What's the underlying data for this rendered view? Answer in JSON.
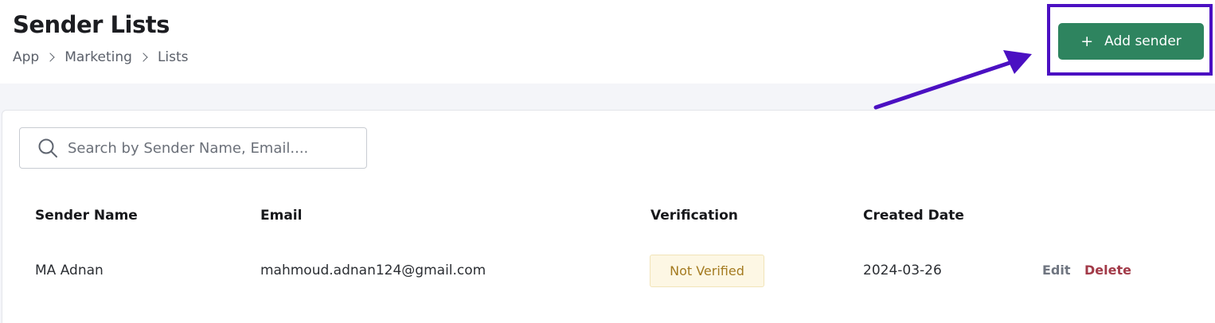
{
  "header": {
    "title": "Sender Lists",
    "breadcrumb": [
      "App",
      "Marketing",
      "Lists"
    ]
  },
  "actions": {
    "add_icon": "+",
    "add_label": "Add sender"
  },
  "search": {
    "placeholder": "Search by Sender Name, Email....",
    "value": ""
  },
  "table": {
    "columns": [
      "Sender Name",
      "Email",
      "Verification",
      "Created Date"
    ],
    "rows": [
      {
        "sender_name": "MA Adnan",
        "email": "mahmoud.adnan124@gmail.com",
        "verification": "Not Verified",
        "created_date": "2024-03-26",
        "edit_label": "Edit",
        "delete_label": "Delete"
      }
    ]
  },
  "colors": {
    "primary_button": "#2e845f",
    "annotation": "#4b10c2",
    "badge_bg": "#fdf7e4",
    "badge_text": "#a47a1f",
    "delete_text": "#a23a48"
  },
  "icons": {
    "search": "search-icon",
    "breadcrumb_separator": "chevron-right-icon"
  }
}
